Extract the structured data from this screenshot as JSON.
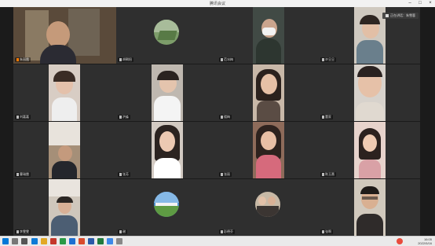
{
  "window": {
    "title": "腾讯会议"
  },
  "speaking": {
    "label": "正在讲话：朱雪蓉"
  },
  "participants": [
    {
      "name": "朱丽霞"
    },
    {
      "name": "胡朝阳"
    },
    {
      "name": "范冰梅"
    },
    {
      "name": "许旦旦"
    },
    {
      "name": "刘嘉嘉"
    },
    {
      "name": "洪淼"
    },
    {
      "name": "楼梅"
    },
    {
      "name": "董家"
    },
    {
      "name": "曹瑞雷"
    },
    {
      "name": "张芳"
    },
    {
      "name": "张丽"
    },
    {
      "name": "陈玉蔷"
    },
    {
      "name": "李雯雯"
    },
    {
      "name": "谢"
    },
    {
      "name": "彭德芬"
    },
    {
      "name": "张啊"
    }
  ],
  "taskbar": {
    "time": "16:05",
    "date": "2022/5/16"
  },
  "colors": {
    "tile_bg": "#2f2f2f",
    "background": "#1b1b1b",
    "mic_on": "#ffffff"
  }
}
